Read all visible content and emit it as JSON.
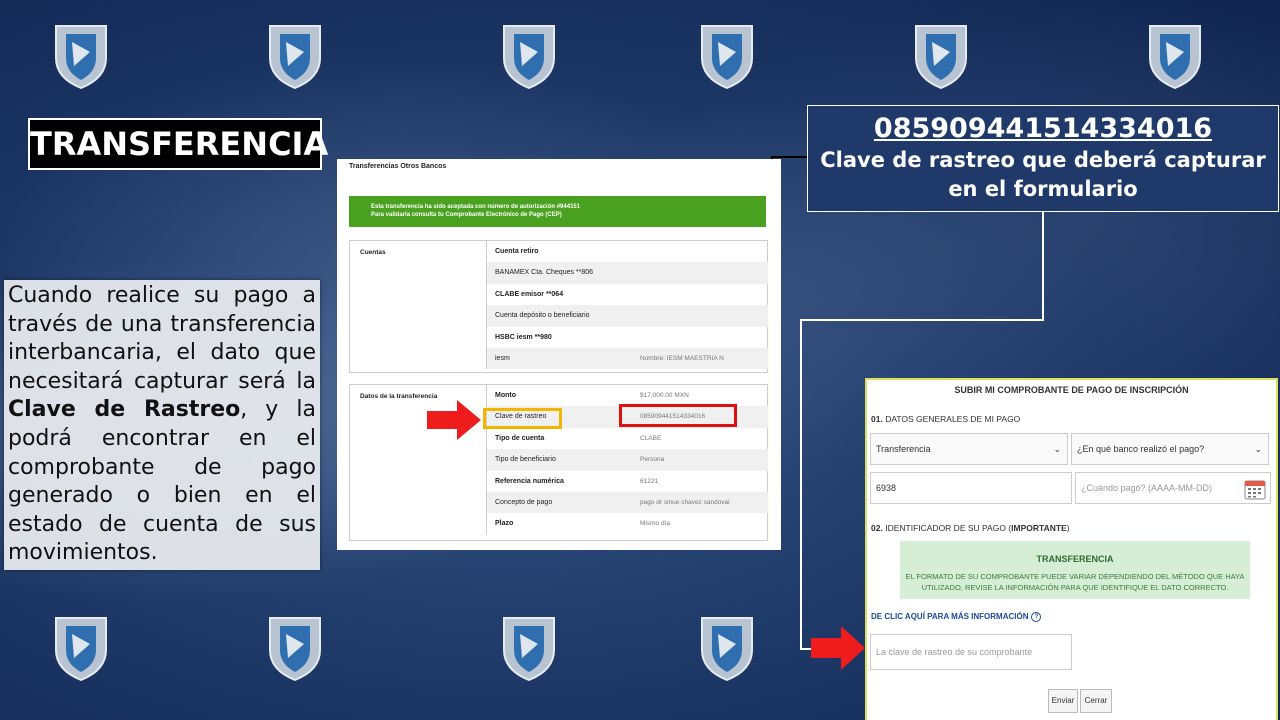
{
  "slide": {
    "title": "TRANSFERENCIA",
    "info_paragraph": {
      "part1": "Cuando realice su pago a través de una transferencia interbancaria, el dato que necesitará capturar será la ",
      "bold": "Clave de Rastreo",
      "part2": ", y la podrá encontrar en el comprobante de pago generado o bien en el estado de cuenta de sus movimientos."
    },
    "callout": {
      "code": "085909441514334016",
      "description": "Clave de rastreo que deberá capturar en el formulario"
    }
  },
  "receipt": {
    "header": "Transferencias Otros Bancos",
    "banner_line1": "Esta transferencia ha sido aceptada con número de autorización #944151",
    "banner_line2": "Para validarla consulta tu Comprobante Electrónico de Pago (CEP)",
    "cuentas": {
      "label": "Cuentas",
      "rows": [
        {
          "text": "Cuenta retiro",
          "value": ""
        },
        {
          "text": "BANAMEX Cta. Cheques **806",
          "value": ""
        },
        {
          "text": "CLABE emisor **064",
          "value": ""
        },
        {
          "text": "Cuenta depósito o beneficiario",
          "value": ""
        },
        {
          "text": "HSBC iesm **980",
          "value": ""
        },
        {
          "text": "iesm",
          "value": "Nombre: IESM MAESTRIA N"
        }
      ]
    },
    "datos": {
      "label": "Datos de la transferencia",
      "rows": [
        {
          "text": "Monto",
          "value": "$17,000.00 MXN"
        },
        {
          "text": "Clave de rastreo",
          "value": "085909441514334016"
        },
        {
          "text": "Tipo de cuenta",
          "value": "CLABE"
        },
        {
          "text": "Tipo de beneficiario",
          "value": "Persona"
        },
        {
          "text": "Referencia numérica",
          "value": "61221"
        },
        {
          "text": "Concepto de pago",
          "value": "pago dr sinue chavez sandoval"
        },
        {
          "text": "Plazo",
          "value": "Mismo día"
        }
      ]
    }
  },
  "form": {
    "title": "SUBIR MI COMPROBANTE DE PAGO DE INSCRIPCIÓN",
    "section1_num": "01.",
    "section1_label": "DATOS GENERALES DE MI PAGO",
    "payment_method": "Transferencia",
    "bank_placeholder": "¿En qué banco realizó el pago?",
    "amount_value": "6938",
    "date_placeholder": "¿Cuándo pagó? (AAAA-MM-DD)",
    "section2_num": "02.",
    "section2_label": "IDENTIFICADOR DE SU PAGO (",
    "section2_important": "IMPORTANTE",
    "section2_close": ")",
    "notice_title": "TRANSFERENCIA",
    "notice_body": "EL FORMATO DE SU COMPROBANTE PUEDE VARIAR DEPENDIENDO DEL MÉTODO QUE HAYA UTILIZADO, REVISE LA INFORMACIÓN PARA QUE IDENTIFIQUE EL DATO CORRECTO.",
    "more_info_link": "DE CLIC AQUÍ PARA MÁS INFORMACIÓN",
    "tracking_placeholder": "La clave de rastreo de su comprobante",
    "send_label": "Enviar",
    "close_label": "Cerrar"
  },
  "icons": {
    "crest": "shield-crest-icon",
    "arrow": "red-arrow-icon",
    "calendar": "calendar-icon",
    "chevron": "chevron-down-icon",
    "info": "info-icon"
  },
  "colors": {
    "background": "#1b3566",
    "callout_bg": "#1f3a6a",
    "banner_green": "#4aa120",
    "highlight_red": "#e01010",
    "highlight_yellow": "#f2b600",
    "notice_green": "#d5eed5"
  }
}
